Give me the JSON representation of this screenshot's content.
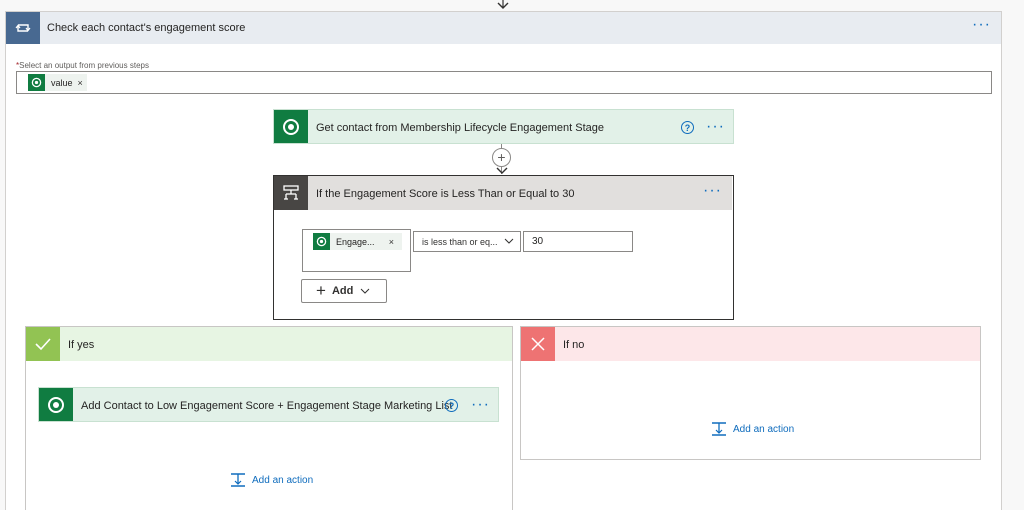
{
  "loop": {
    "title": "Check each contact's engagement score",
    "select_label_required": "*",
    "select_label": "Select an output from previous steps",
    "token": "value",
    "token_remove": "×"
  },
  "get_contact": {
    "title": "Get contact from Membership Lifecycle Engagement Stage",
    "help": "?"
  },
  "condition": {
    "title": "If the Engagement Score is Less Than or Equal to 30",
    "operand": "Engage...",
    "operand_remove": "×",
    "operator": "is less than or eq...",
    "value": "30",
    "add_label": "Add"
  },
  "if_yes": {
    "title": "If yes",
    "action_title": "Add Contact to Low Engagement Score + Engagement Stage Marketing List",
    "help": "?",
    "add_action": "Add an action"
  },
  "if_no": {
    "title": "If no",
    "add_action": "Add an action"
  },
  "colors": {
    "loop_accent": "#486991",
    "dataverse_green": "#107c41",
    "yes_header": "#e7f5e3",
    "yes_icon": "#92c353",
    "no_header": "#fde7e9",
    "no_icon": "#ee7373",
    "link": "#0f6cbd"
  },
  "icons": {
    "loop": "loop-arrows-icon",
    "dataverse": "dataverse-logo-icon",
    "condition": "condition-branch-icon",
    "yes": "checkmark-icon",
    "no": "x-icon",
    "add_action": "add-action-icon"
  }
}
